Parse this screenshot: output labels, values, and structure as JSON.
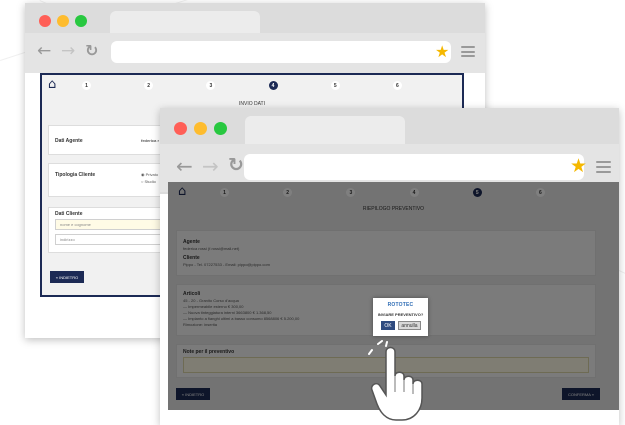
{
  "back_window": {
    "steps": [
      "1",
      "2",
      "3",
      "4",
      "5",
      "6"
    ],
    "active_step": "4",
    "section_title": "INVIO DATI",
    "agent_label": "Dati Agente",
    "agent_value": "federica r",
    "client_type_label": "Tipologia Cliente",
    "radio_option_1": "Privato",
    "radio_option_2": "Studio",
    "client_data_label": "Dati Cliente",
    "name_placeholder": "nome e cognome",
    "address_placeholder": "indirizzo",
    "back_button": "« INDIETRO"
  },
  "front_window": {
    "steps": [
      "1",
      "2",
      "3",
      "4",
      "5",
      "6"
    ],
    "active_step": "5",
    "section_title": "RIEPILOGO PREVENTIVO",
    "agent_label": "Agente",
    "agent_value": "federica rossi (f.rossi@mail.net)",
    "client_label": "Cliente",
    "client_value": "Pippo - Tel. 07227533 - Email: pippo@pippo.com",
    "articles_label": "Articoli",
    "article_lines": [
      "45 - 20 - Granito Corso d'acqua",
      "— Impermeabile esterno      € 300,00",
      "— Nuova tinteggiatura interni 3663800      € 1.368,50",
      "— Impianto a fianghi ultimi a basso consumo 8568806      € 5.200,00",
      "Rimozione: inserita"
    ],
    "notes_label": "Note per il preventivo",
    "back_button": "« INDIETRO",
    "confirm_button": "CONFERMA »"
  },
  "modal": {
    "brand": "ROTOTEC",
    "question": "INVIARE PREVENTIVO?",
    "ok_label": "OK",
    "cancel_label": "annulla"
  },
  "colors": {
    "navy": "#1c2a55",
    "dot_red": "#ff5f57",
    "dot_yellow": "#febc2e",
    "dot_green": "#28c840",
    "star": "#f5b800",
    "brand_blue": "#2f6db5"
  },
  "icons": {
    "back": "arrow-left-icon",
    "forward": "arrow-right-icon",
    "reload": "reload-icon",
    "bookmark": "star-icon",
    "menu": "hamburger-menu-icon",
    "home": "home-icon",
    "pointer": "hand-pointer-icon"
  }
}
